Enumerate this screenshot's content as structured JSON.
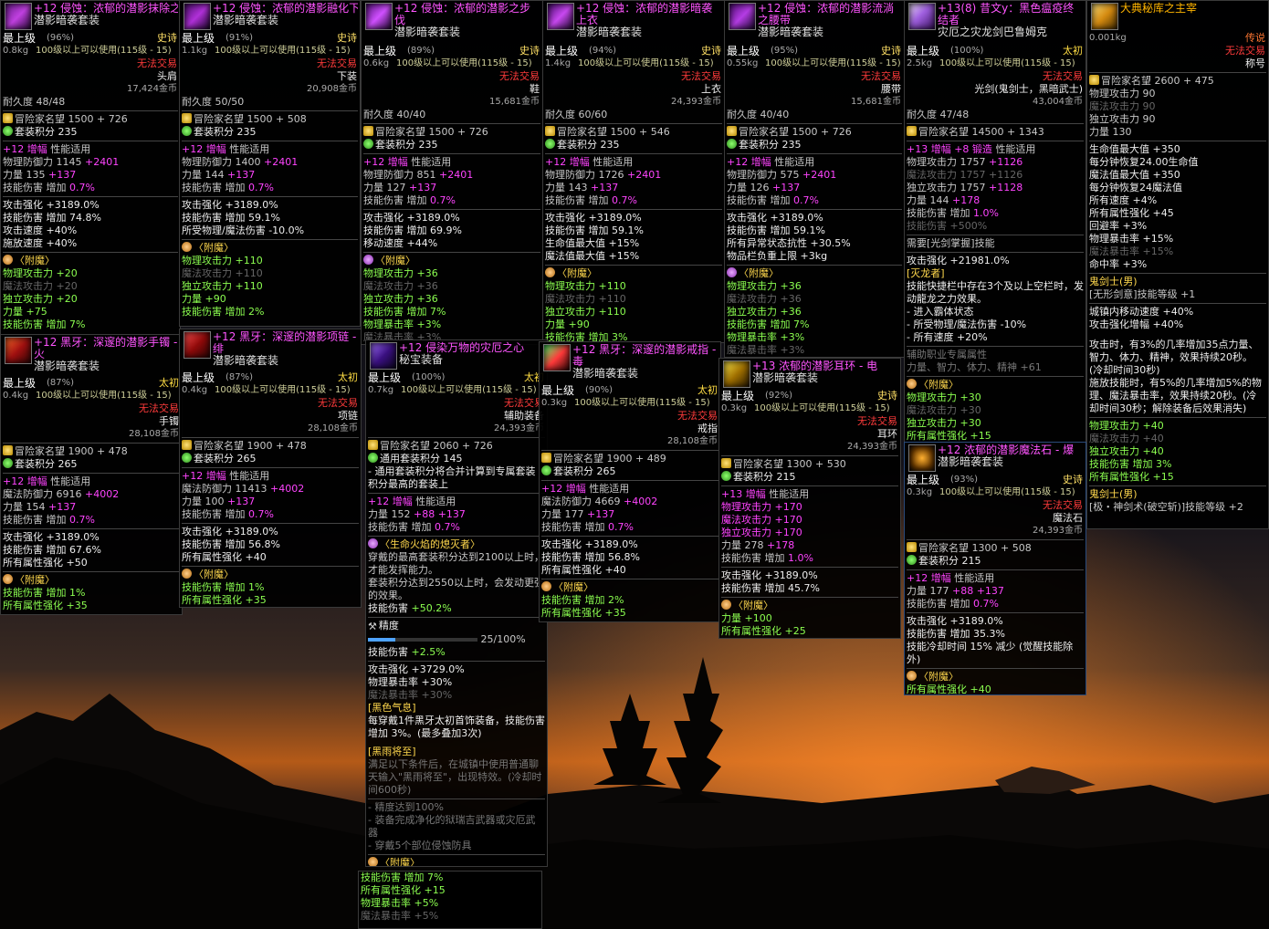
{
  "colors": {
    "magenta": "#ff44ff",
    "green": "#8cff50",
    "gold": "#ffd84d",
    "red": "#ff3b3b"
  },
  "t1": {
    "icon": "helmet-icon",
    "name": "+12 侵蚀：浓郁的潜影抹除之容貌",
    "set": "潜影暗袭套装",
    "grade": "最上级",
    "pct": "(96%)",
    "rarity": "史诗",
    "weight": "0.8kg",
    "req": "100级以上可以使用(115级 - 15)",
    "trade": "无法交易",
    "slot": "头肩",
    "price": "17,424金币",
    "dura": "耐久度 48/48",
    "fame": "冒险家名望 1500 + 726",
    "setpts": "套装积分 235",
    "amp": "+12 增幅",
    "ampd": "性能适用",
    "s1": "物理防御力 1145",
    "s1b": "+2401",
    "s2": "力量 135",
    "s2b": "+137",
    "s3": "技能伤害 增加",
    "s3b": "0.7%",
    "a1": "攻击强化 +3189.0%",
    "a2": "技能伤害 增加 74.8%",
    "a3": "攻击速度 +40%",
    "a4": "施放速度 +40%",
    "enc": "〈附魔〉",
    "e1": "物理攻击力 +20",
    "e2": "魔法攻击力 +20",
    "e3": "独立攻击力 +20",
    "e4": "力量 +75",
    "e5": "技能伤害 增加 7%"
  },
  "t2": {
    "icon": "pants-icon",
    "name": "+12 侵蚀：浓郁的潜影融化下装",
    "set": "潜影暗袭套装",
    "grade": "最上级",
    "pct": "(91%)",
    "rarity": "史诗",
    "weight": "1.1kg",
    "req": "100级以上可以使用(115级 - 15)",
    "trade": "无法交易",
    "slot": "下装",
    "price": "20,908金币",
    "dura": "耐久度 50/50",
    "fame": "冒险家名望 1500 + 508",
    "setpts": "套装积分 235",
    "amp": "+12 增幅",
    "ampd": "性能适用",
    "s1": "物理防御力 1400",
    "s1b": "+2401",
    "s2": "力量 144",
    "s2b": "+137",
    "s3": "技能伤害 增加",
    "s3b": "0.7%",
    "a1": "攻击强化 +3189.0%",
    "a2": "技能伤害 增加 59.1%",
    "a3": "所受物理/魔法伤害 -10.0%",
    "enc": "〈附魔〉",
    "e1": "物理攻击力 +110",
    "e2": "魔法攻击力 +110",
    "e3": "独立攻击力 +110",
    "e4": "力量 +90",
    "e5": "技能伤害 增加 2%"
  },
  "t3": {
    "icon": "shoes-icon",
    "name": "+12 侵蚀：浓郁的潜影之步伐",
    "set": "潜影暗袭套装",
    "grade": "最上级",
    "pct": "(89%)",
    "rarity": "史诗",
    "weight": "0.6kg",
    "req": "100级以上可以使用(115级 - 15)",
    "trade": "无法交易",
    "slot": "鞋",
    "price": "15,681金币",
    "dura": "耐久度 40/40",
    "fame": "冒险家名望 1500 + 726",
    "setpts": "套装积分 235",
    "amp": "+12 增幅",
    "ampd": "性能适用",
    "s1": "物理防御力 851",
    "s1b": "+2401",
    "s2": "力量 127",
    "s2b": "+137",
    "s3": "技能伤害 增加",
    "s3b": "0.7%",
    "a1": "攻击强化 +3189.0%",
    "a2": "技能伤害 增加 69.9%",
    "a3": "移动速度 +44%",
    "enc": "〈附魔〉",
    "e1": "物理攻击力 +36",
    "e2": "魔法攻击力 +36",
    "e3": "独立攻击力 +36",
    "e4": "技能伤害 增加 7%",
    "e5": "物理暴击率 +3%",
    "e6": "魔法暴击率 +3%"
  },
  "t4": {
    "icon": "coat-icon",
    "name": "+12 侵蚀：浓郁的潜影暗袭上衣",
    "set": "潜影暗袭套装",
    "grade": "最上级",
    "pct": "(94%)",
    "rarity": "史诗",
    "weight": "1.4kg",
    "req": "100级以上可以使用(115级 - 15)",
    "trade": "无法交易",
    "slot": "上衣",
    "price": "24,393金币",
    "dura": "耐久度 60/60",
    "fame": "冒险家名望 1500 + 546",
    "setpts": "套装积分 235",
    "amp": "+12 增幅",
    "ampd": "性能适用",
    "s1": "物理防御力 1726",
    "s1b": "+2401",
    "s2": "力量 143",
    "s2b": "+137",
    "s3": "技能伤害 增加",
    "s3b": "0.7%",
    "a1": "攻击强化 +3189.0%",
    "a2": "技能伤害 增加 59.1%",
    "a3": "生命值最大值 +15%",
    "a4": "魔法值最大值 +15%",
    "enc": "〈附魔〉",
    "e1": "物理攻击力 +110",
    "e2": "魔法攻击力 +110",
    "e3": "独立攻击力 +110",
    "e4": "力量 +90",
    "e5": "技能伤害 增加 3%"
  },
  "t5": {
    "icon": "belt-icon",
    "name": "+12 侵蚀：浓郁的潜影流淌之腰带",
    "set": "潜影暗袭套装",
    "grade": "最上级",
    "pct": "(95%)",
    "rarity": "史诗",
    "weight": "0.55kg",
    "req": "100级以上可以使用(115级 - 15)",
    "trade": "无法交易",
    "slot": "腰带",
    "price": "15,681金币",
    "dura": "耐久度 40/40",
    "fame": "冒险家名望 1500 + 726",
    "setpts": "套装积分 235",
    "amp": "+12 增幅",
    "ampd": "性能适用",
    "s1": "物理防御力 575",
    "s1b": "+2401",
    "s2": "力量 126",
    "s2b": "+137",
    "s3": "技能伤害 增加",
    "s3b": "0.7%",
    "a1": "攻击强化 +3189.0%",
    "a2": "技能伤害 增加 59.1%",
    "a3": "所有异常状态抗性 +30.5%",
    "a4": "物品栏负重上限 +3kg",
    "enc": "〈附魔〉",
    "e1": "物理攻击力 +36",
    "e2": "魔法攻击力 +36",
    "e3": "独立攻击力 +36",
    "e4": "技能伤害 增加 7%",
    "e5": "物理暴击率 +3%",
    "e6": "魔法暴击率 +3%"
  },
  "t6": {
    "icon": "sword-icon",
    "name": "+13(8) 昔文y：黑色瘟疫终结者",
    "sub": "灾厄之灾龙剑巴鲁姆克",
    "grade": "最上级",
    "pct": "(100%)",
    "rarity": "太初",
    "weight": "2.5kg",
    "req": "100级以上可以使用(115级 - 15)",
    "trade": "无法交易",
    "slot": "光剑(鬼剑士，黑暗武士)",
    "price": "43,004金币",
    "dura": "耐久度 47/48",
    "fame": "冒险家名望 14500 + 1343",
    "amp": "+13 增幅",
    "forge": "+8 锻造",
    "ampd": "性能适用",
    "s1": "物理攻击力 1757",
    "s1b": "+1126",
    "s2": "魔法攻击力 1757",
    "s2b": "+1126",
    "s3": "独立攻击力 1757",
    "s3b": "+1128",
    "s4": "力量 144",
    "s4b": "+178",
    "s5": "技能伤害 增加",
    "s5b": "1.0%",
    "s6": "技能伤害 +500%",
    "need": "需要[光剑掌握]技能",
    "a1": "攻击强化 +21981.0%",
    "head": "[灭龙者]",
    "d1": "技能快捷栏中存在3个及以上空栏时，发动龍龙之力效果。",
    "d2": "- 进入霸体状态",
    "d3": "- 所受物理/魔法伤害 -10%",
    "d4": "- 所有速度 +20%",
    "aux": "辅助职业专属属性",
    "aux2": "力量、智力、体力、精神 +61",
    "enc": "〈附魔〉",
    "e1": "物理攻击力 +30",
    "e2": "魔法攻击力 +30",
    "e3": "独立攻击力 +30",
    "e4": "所有属性强化 +15"
  },
  "t7": {
    "icon": "title-icon",
    "name": "大典秘库之主宰",
    "weight": "0.001kg",
    "rarity": "传说",
    "trade": "无法交易",
    "slot": "称号",
    "fame": "冒险家名望 2600 + 475",
    "s1": "物理攻击力 90",
    "s2": "魔法攻击力 90",
    "s3": "独立攻击力 90",
    "s4": "力量 130",
    "b1": "生命值最大值 +350",
    "b2": "每分钟恢复24.00生命值",
    "b3": "魔法值最大值 +350",
    "b4": "每分钟恢复24魔法值",
    "b5": "所有速度 +4%",
    "b6": "所有属性强化 +45",
    "b7": "回避率 +3%",
    "b8": "物理暴击率 +15%",
    "b9": "魔法暴击率 +15%",
    "b10": "命中率 +3%",
    "job": "鬼剑士(男)",
    "jobsk": "[无形剑意]技能等级 +1",
    "c1": "城镇内移动速度 +40%",
    "c2": "攻击强化增幅 +40%",
    "c3": "攻击时，有3%的几率增加35点力量、智力、体力、精神，效果持续20秒。(冷却时间30秒)",
    "c4": "施放技能时，有5%的几率增加5%的物理、魔法暴击率，效果持续20秒。(冷却时间30秒；解除装备后效果消失)",
    "e1": "物理攻击力 +40",
    "e2": "魔法攻击力 +40",
    "e3": "独立攻击力 +40",
    "e4": "技能伤害 增加 3%",
    "e5": "所有属性强化 +15",
    "job2": "鬼剑士(男)",
    "job2sk": "[极・神剑术(破空斩)]技能等级 +2"
  },
  "t8": {
    "icon": "gloves-icon",
    "name": "+12 黑牙：深邃的潜影手镯 - 火",
    "set": "潜影暗袭套装",
    "grade": "最上级",
    "pct": "(87%)",
    "rarity": "太初",
    "weight": "0.4kg",
    "req": "100级以上可以使用(115级 - 15)",
    "trade": "无法交易",
    "slot": "手镯",
    "price": "28,108金币",
    "fame": "冒险家名望 1900 + 478",
    "setpts": "套装积分 265",
    "amp": "+12 增幅",
    "ampd": "性能适用",
    "s1": "魔法防御力 6916",
    "s1b": "+4002",
    "s2": "力量 154",
    "s2b": "+137",
    "s3": "技能伤害 增加",
    "s3b": "0.7%",
    "a1": "攻击强化 +3189.0%",
    "a2": "技能伤害 增加 67.6%",
    "a3": "所有属性强化 +50",
    "enc": "〈附魔〉",
    "e1": "技能伤害 增加 1%",
    "e2": "所有属性强化 +35"
  },
  "t9": {
    "icon": "necklace-icon",
    "name": "+12 黑牙：深邃的潜影项链 - 绯",
    "set": "潜影暗袭套装",
    "grade": "最上级",
    "pct": "(87%)",
    "rarity": "太初",
    "weight": "0.4kg",
    "req": "100级以上可以使用(115级 - 15)",
    "trade": "无法交易",
    "slot": "项链",
    "price": "28,108金币",
    "fame": "冒险家名望 1900 + 478",
    "setpts": "套装积分 265",
    "amp": "+12 增幅",
    "ampd": "性能适用",
    "s1": "魔法防御力 11413",
    "s1b": "+4002",
    "s2": "力量 100",
    "s2b": "+137",
    "s3": "技能伤害 增加",
    "s3b": "0.7%",
    "a1": "攻击强化 +3189.0%",
    "a2": "技能伤害 增加 56.8%",
    "a3": "所有属性强化 +40",
    "enc": "〈附魔〉",
    "e1": "技能伤害 增加 1%",
    "e2": "所有属性强化 +35"
  },
  "t10": {
    "icon": "support-icon",
    "name": "+12 侵染万物的灾厄之心",
    "set": "秘宝装备",
    "grade": "最上级",
    "pct": "(100%)",
    "rarity": "太初",
    "weight": "0.7kg",
    "req": "100级以上可以使用(115级 - 15)",
    "trade": "无法交易",
    "slot": "辅助装备",
    "price": "24,393金币",
    "fame": "冒险家名望 2060 + 726",
    "setpts": "通用套装积分 145",
    "gen": "- 通用套装积分将合并计算到专属套装积分最高的套装上",
    "amp": "+12 增幅",
    "ampd": "性能适用",
    "s1": "力量 152",
    "s1b": "+88",
    "s1c": "+137",
    "s2": "技能伤害 增加",
    "s2b": "0.7%",
    "life": "〈生命火焰的熄灭者〉",
    "life2": "穿戴的最高套装积分达到2100以上时，才能发挥能力。",
    "life3": "套装积分达到2550以上时，会发动更强的效果。",
    "life4": "技能伤害",
    "life4b": "+50.2%",
    "prec": "精度",
    "prog": "25/100%",
    "sk": "技能伤害",
    "skb": "+2.5%",
    "a1": "攻击强化 +3729.0%",
    "a2": "物理暴击率 +30%",
    "a3": "魔法暴击率 +30%",
    "bh": "[黑色气息]",
    "bh2": "每穿戴1件黑牙太初首饰装备，技能伤害 增加 3%。(最多叠加3次)",
    "br": "[黑雨将至]",
    "br2": "满足以下条件后，在城镇中使用普通聊天输入\"黑雨将至\"，出现特效。(冷却时间600秒)",
    "br3": "- 精度达到100%",
    "br4": "- 装备完成净化的狱瑞吉武器或灾厄武器",
    "br5": "- 穿戴5个部位侵蚀防具",
    "enc": "〈附魔〉",
    "e1": "技能伤害 增加 7%",
    "e2": "所有属性强化 +15",
    "e3": "物理暴击率 +5%",
    "e4": "魔法暴击率 +5%"
  },
  "t11": {
    "icon": "ring-icon",
    "name": "+12 黑牙：深邃的潜影戒指 - 毒",
    "set": "潜影暗袭套装",
    "grade": "最上级",
    "pct": "(90%)",
    "rarity": "太初",
    "weight": "0.3kg",
    "req": "100级以上可以使用(115级 - 15)",
    "trade": "无法交易",
    "slot": "戒指",
    "price": "28,108金币",
    "fame": "冒险家名望 1900 + 489",
    "setpts": "套装积分 265",
    "amp": "+12 增幅",
    "ampd": "性能适用",
    "s1": "魔法防御力 4669",
    "s1b": "+4002",
    "s2": "力量 177",
    "s2b": "+137",
    "s3": "技能伤害 增加",
    "s3b": "0.7%",
    "a1": "攻击强化 +3189.0%",
    "a2": "技能伤害 增加 56.8%",
    "a3": "所有属性强化 +40",
    "enc": "〈附魔〉",
    "e1": "技能伤害 增加 2%",
    "e2": "所有属性强化 +35"
  },
  "t12": {
    "icon": "earring-icon",
    "name": "+13 浓郁的潜影耳环 - 电",
    "set": "潜影暗袭套装",
    "grade": "最上级",
    "pct": "(92%)",
    "rarity": "史诗",
    "weight": "0.3kg",
    "req": "100级以上可以使用(115级 - 15)",
    "trade": "无法交易",
    "slot": "耳环",
    "price": "24,393金币",
    "fame": "冒险家名望 1300 + 530",
    "setpts": "套装积分 215",
    "amp": "+13 增幅",
    "ampd": "性能适用",
    "s1": "物理攻击力 +170",
    "s2": "魔法攻击力 +170",
    "s3": "独立攻击力 +170",
    "s4": "力量 278",
    "s4b": "+178",
    "s5": "技能伤害 增加",
    "s5b": "1.0%",
    "a1": "攻击强化 +3189.0%",
    "a2": "技能伤害 增加 45.7%",
    "enc": "〈附魔〉",
    "e1": "力量 +100",
    "e2": "所有属性强化 +25"
  },
  "t13": {
    "icon": "magic-stone-icon",
    "name": "+12 浓郁的潜影魔法石 - 爆",
    "set": "潜影暗袭套装",
    "grade": "最上级",
    "pct": "(93%)",
    "rarity": "史诗",
    "weight": "0.3kg",
    "req": "100级以上可以使用(115级 - 15)",
    "trade": "无法交易",
    "slot": "魔法石",
    "price": "24,393金币",
    "fame": "冒险家名望 1300 + 508",
    "setpts": "套装积分 215",
    "amp": "+12 增幅",
    "ampd": "性能适用",
    "s1": "力量 177",
    "s1b": "+88",
    "s1c": "+137",
    "s2": "技能伤害 增加",
    "s2b": "0.7%",
    "a1": "攻击强化 +3189.0%",
    "a2": "技能伤害 增加 35.3%",
    "a3": "技能冷却时间 15% 减少 (觉醒技能除外)",
    "enc": "〈附魔〉",
    "e1": "所有属性强化 +40"
  }
}
